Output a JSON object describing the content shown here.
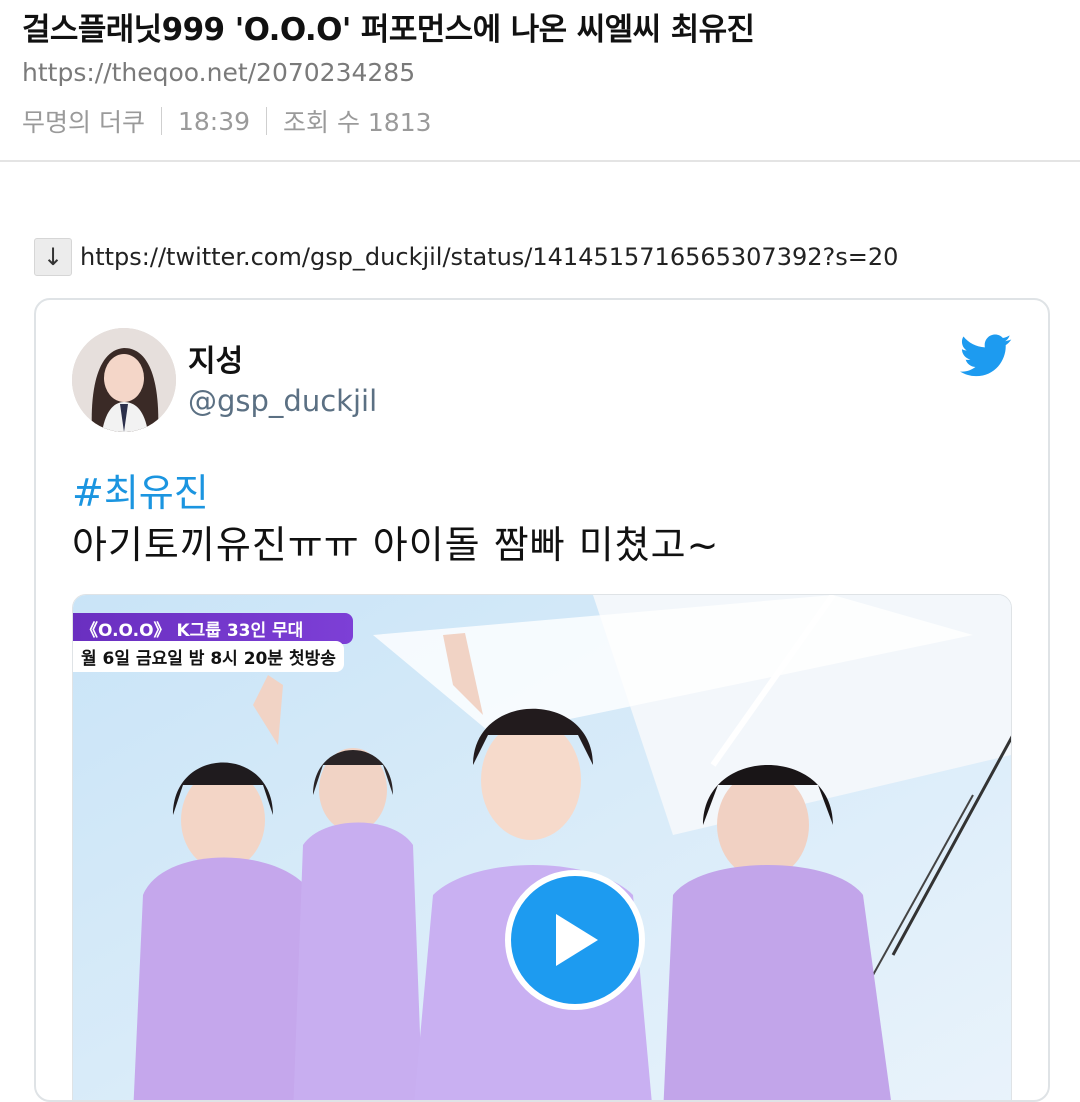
{
  "post": {
    "title": "걸스플래닛999 'O.O.O' 퍼포먼스에 나온 씨엘씨 최유진",
    "url": "https://theqoo.net/2070234285",
    "author": "무명의 더쿠",
    "time": "18:39",
    "views": "조회 수 1813"
  },
  "link": {
    "arrow": "↓",
    "href_text": "https://twitter.com/gsp_duckjil/status/1414515716565307392?s=20"
  },
  "tweet": {
    "display_name": "지성",
    "handle": "@gsp_duckjil",
    "hashtag": "#최유진",
    "text": "아기토끼유진ㅠㅠ 아이돌 짬빠 미쳤고~",
    "media": {
      "caption_line1": "《O.O.O》 K그룹 33인 무대",
      "caption_line2": "월 6일 금요일 밤 8시 20분 첫방송"
    }
  },
  "icons": {
    "bird": "twitter-bird-icon",
    "play": "play-icon",
    "arrow": "down-arrow-icon"
  },
  "colors": {
    "twitter_blue": "#1d9bf0",
    "hashtag_blue": "#1b95e0",
    "caption_purple": "#6a2fc0"
  }
}
